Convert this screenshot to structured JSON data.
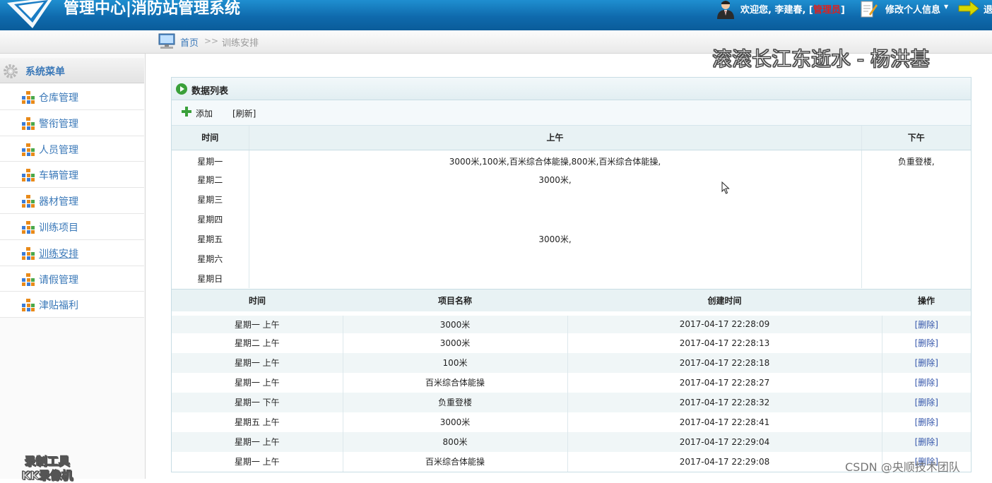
{
  "header": {
    "title": "管理中心|消防站管理系统",
    "welcome_prefix": "欢迎您, 李建春, [",
    "role": "管理员",
    "welcome_suffix": "]",
    "edit_profile": "修改个人信息",
    "exit": "退"
  },
  "breadcrumb": {
    "home": "首页",
    "separator": ">>",
    "current": "训练安排"
  },
  "sidebar": {
    "title": "系统菜单",
    "items": [
      {
        "label": "仓库管理"
      },
      {
        "label": "警衔管理"
      },
      {
        "label": "人员管理"
      },
      {
        "label": "车辆管理"
      },
      {
        "label": "器材管理"
      },
      {
        "label": "训练项目"
      },
      {
        "label": "训练安排"
      },
      {
        "label": "请假管理"
      },
      {
        "label": "津贴福利"
      }
    ]
  },
  "overlays": {
    "song": "滚滚长江东逝水 - 杨洪基",
    "recorder_line1": "录制工具",
    "recorder_line2": "KK录像机",
    "csdn": "CSDN @央顺技术团队"
  },
  "panel": {
    "title": "数据列表",
    "add": "添加",
    "refresh": "[刷新]"
  },
  "schedule": {
    "headers": {
      "time": "时间",
      "am": "上午",
      "pm": "下午"
    },
    "rows": [
      {
        "day": "星期一",
        "am": "3000米,100米,百米综合体能操,800米,百米综合体能操,",
        "pm": "负重登楼,"
      },
      {
        "day": "星期二",
        "am": "3000米,",
        "pm": ""
      },
      {
        "day": "星期三",
        "am": "",
        "pm": ""
      },
      {
        "day": "星期四",
        "am": "",
        "pm": ""
      },
      {
        "day": "星期五",
        "am": "3000米,",
        "pm": ""
      },
      {
        "day": "星期六",
        "am": "",
        "pm": ""
      },
      {
        "day": "星期日",
        "am": "",
        "pm": ""
      }
    ]
  },
  "records": {
    "headers": {
      "time": "时间",
      "project": "项目名称",
      "created": "创建时间",
      "action": "操作"
    },
    "delete_label": "[删除]",
    "rows": [
      {
        "time": "星期一 上午",
        "project": "3000米",
        "created": "2017-04-17 22:28:09"
      },
      {
        "time": "星期二 上午",
        "project": "3000米",
        "created": "2017-04-17 22:28:13"
      },
      {
        "time": "星期一 上午",
        "project": "100米",
        "created": "2017-04-17 22:28:18"
      },
      {
        "time": "星期一 上午",
        "project": "百米综合体能操",
        "created": "2017-04-17 22:28:27"
      },
      {
        "time": "星期一 下午",
        "project": "负重登楼",
        "created": "2017-04-17 22:28:32"
      },
      {
        "time": "星期五 上午",
        "project": "3000米",
        "created": "2017-04-17 22:28:41"
      },
      {
        "time": "星期一 上午",
        "project": "800米",
        "created": "2017-04-17 22:29:04"
      },
      {
        "time": "星期一 上午",
        "project": "百米综合体能操",
        "created": "2017-04-17 22:29:08"
      }
    ]
  },
  "colors": {
    "header_blue": "#0f6aad",
    "link_blue": "#3a78b8",
    "role_red": "#e0201c",
    "table_header": "#e8f2f4"
  }
}
